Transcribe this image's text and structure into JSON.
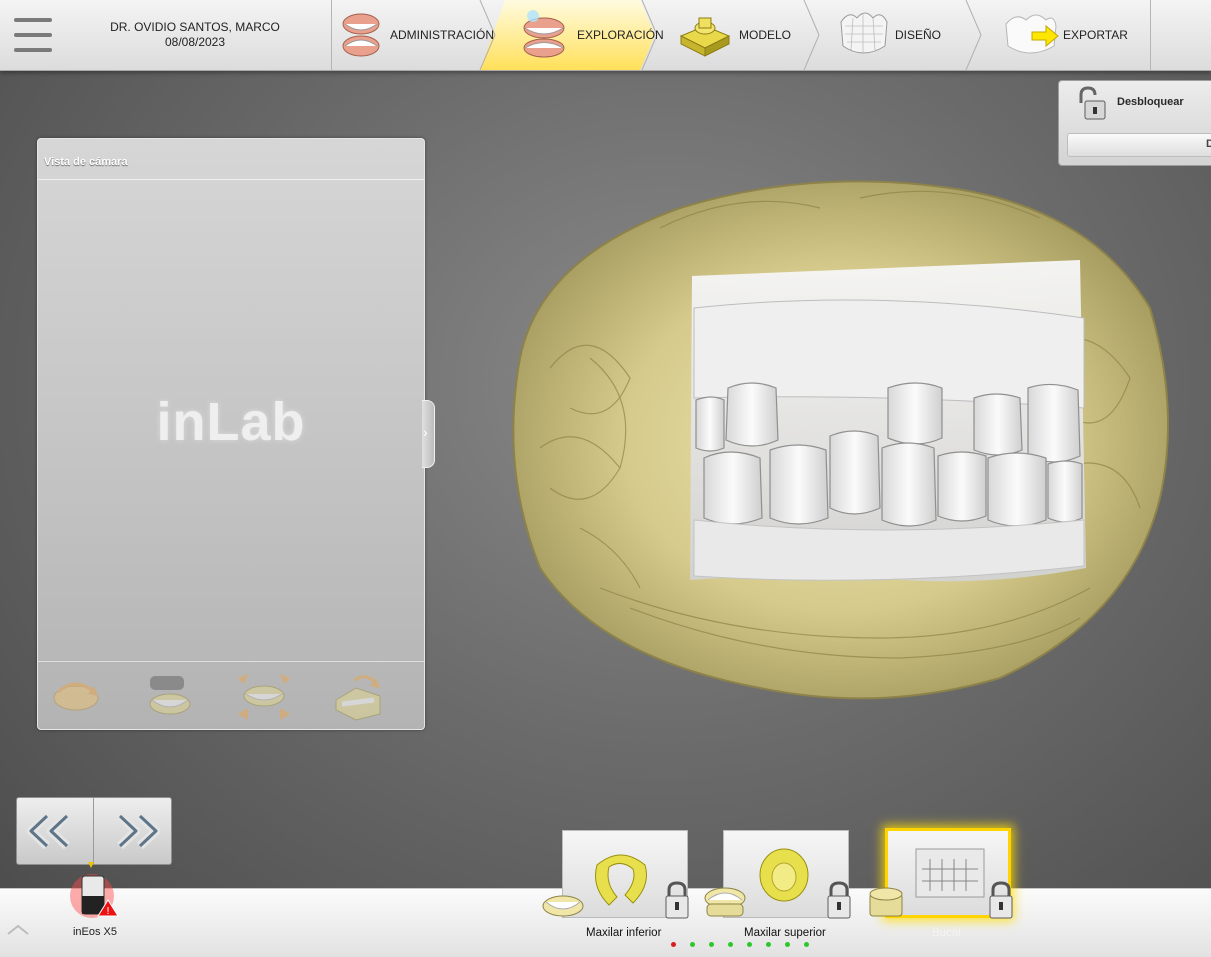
{
  "header": {
    "patient_name": "DR. OVIDIO SANTOS, MARCO",
    "patient_date": "08/08/2023",
    "steps": [
      {
        "label": "ADMINISTRACIÓN",
        "active": false
      },
      {
        "label": "EXPLORACIÓN",
        "active": true
      },
      {
        "label": "MODELO",
        "active": false
      },
      {
        "label": "DISEÑO",
        "active": false
      },
      {
        "label": "EXPORTAR",
        "active": false
      }
    ]
  },
  "unlock_panel": {
    "label": "Desbloquear",
    "sub_label": "D"
  },
  "camera_panel": {
    "title": "Vista de cámara",
    "logo": "inLab",
    "tools": [
      "rotate-model-icon",
      "jaw-toggle-icon",
      "expand-arch-icon",
      "buccal-view-icon"
    ]
  },
  "device": {
    "name": "inEos X5",
    "status": "warning"
  },
  "catalog": {
    "items": [
      {
        "label": "Maxilar inferior",
        "locked": true
      },
      {
        "label": "Maxilar superior",
        "locked": true
      },
      {
        "label": "Bucal",
        "locked": true,
        "active": true
      }
    ],
    "dots": 8
  },
  "colors": {
    "accent": "#ffd400",
    "model_stone": "#d9cf8f",
    "scan_white": "#ececec"
  }
}
